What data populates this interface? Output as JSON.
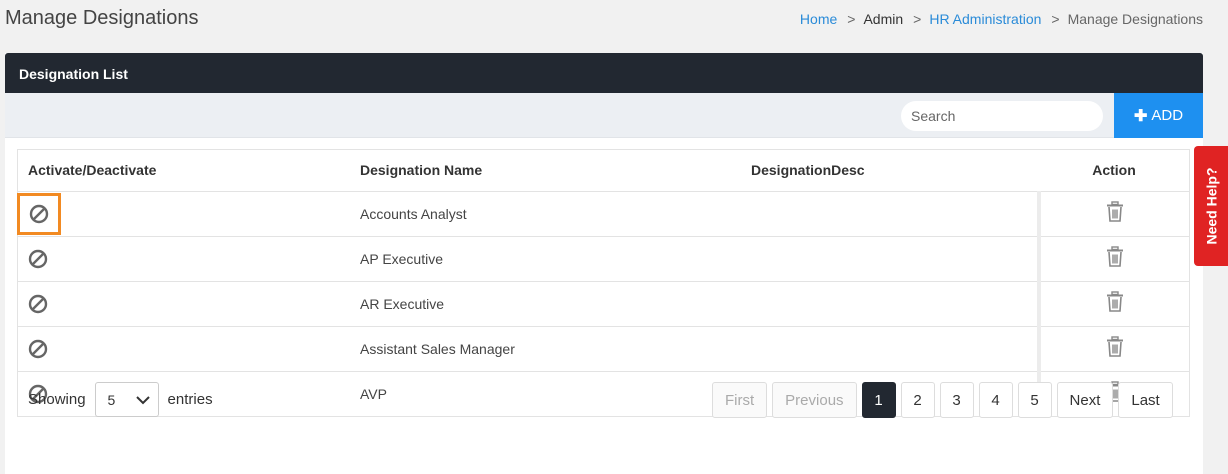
{
  "page": {
    "title": "Manage Designations"
  },
  "breadcrumb": {
    "items": [
      {
        "label": "Home"
      },
      {
        "label": "Admin"
      },
      {
        "label": "HR Administration"
      },
      {
        "label": "Manage Designations"
      }
    ],
    "separator": ">"
  },
  "panel": {
    "title": "Designation List",
    "search_placeholder": "Search",
    "add_label": "ADD",
    "add_icon": "plus-icon"
  },
  "table": {
    "headers": {
      "activate": "Activate/Deactivate",
      "name": "Designation Name",
      "desc": "DesignationDesc",
      "action": "Action"
    },
    "rows": [
      {
        "name": "Accounts Analyst",
        "desc": "",
        "status_icon": "ban-icon",
        "action_icon": "trash-icon"
      },
      {
        "name": "AP Executive",
        "desc": "",
        "status_icon": "ban-icon",
        "action_icon": "trash-icon"
      },
      {
        "name": "AR Executive",
        "desc": "",
        "status_icon": "ban-icon",
        "action_icon": "trash-icon"
      },
      {
        "name": "Assistant Sales Manager",
        "desc": "",
        "status_icon": "ban-icon",
        "action_icon": "trash-icon"
      },
      {
        "name": "AVP",
        "desc": "",
        "status_icon": "ban-icon",
        "action_icon": "trash-icon"
      }
    ]
  },
  "footer": {
    "showing_label": "Showing",
    "entries_value": "5",
    "entries_label": "entries"
  },
  "pagination": {
    "first": "First",
    "previous": "Previous",
    "pages": [
      "1",
      "2",
      "3",
      "4",
      "5"
    ],
    "current": "1",
    "next": "Next",
    "last": "Last"
  },
  "help": {
    "label": "Need Help?"
  },
  "colors": {
    "header_bg": "#222831",
    "accent": "#1e90f0",
    "help_bg": "#e02323",
    "highlight": "#f28a22"
  }
}
